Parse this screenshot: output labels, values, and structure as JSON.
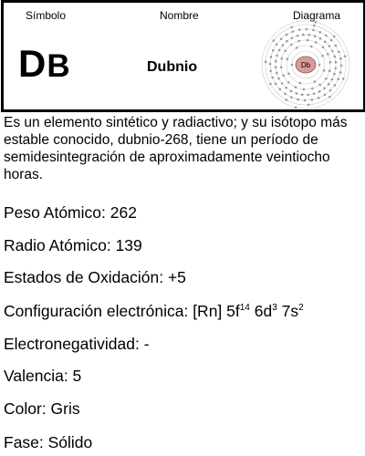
{
  "card": {
    "headers": {
      "symbol": "Símbolo",
      "name": "Nombre",
      "diagram": "Diagrama"
    },
    "symbol_cap": "D",
    "symbol_low": "B",
    "element_name": "Dubnio",
    "nucleus_label": "Db",
    "colors": {
      "nucleus_fill": "#d99a96",
      "shell_dots": "#9a9a9a",
      "shells": "#c8c8c8"
    }
  },
  "description": "Es un elemento sintético y radiactivo; y su isótopo más estable conocido, dubnio-268, tiene un período de semidesintegración de aproximadamente veintiocho horas.",
  "properties": {
    "weight": "Peso Atómico: 262",
    "radius": "Radio Atómico: 139",
    "oxidation": "Estados de Oxidación: +5",
    "config_label": "Configuración electrónica: [Rn] 5f",
    "config_s1": "14",
    "config_mid1": " 6d",
    "config_s2": "3",
    "config_mid2": " 7s",
    "config_s3": "2",
    "electroneg": "Electronegatividad: -",
    "valence": "Valencia: 5",
    "color": "Color: Gris",
    "phase": "Fase: Sólido"
  }
}
